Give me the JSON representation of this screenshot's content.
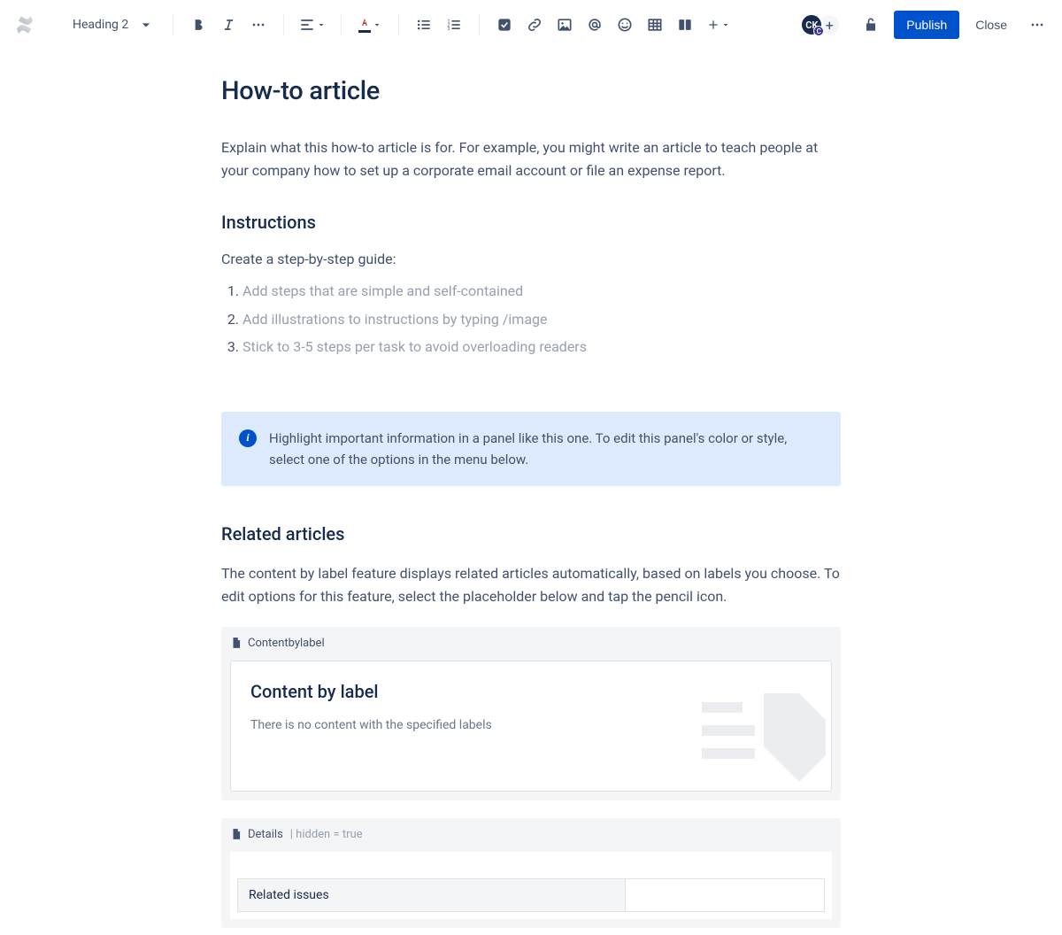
{
  "toolbar": {
    "style_label": "Heading 2",
    "publish": "Publish",
    "close": "Close"
  },
  "avatar": {
    "initials": "CK",
    "badge": "C"
  },
  "page": {
    "title": "How-to article",
    "intro": "Explain what this how-to article is for. For example, you might write an article to teach people at your company how to set up a corporate email account or file an expense report.",
    "instructions_heading": "Instructions",
    "instructions_sub": "Create a step-by-step guide:",
    "steps": [
      "Add steps that are simple and self-contained",
      "Add illustrations to instructions by typing /image",
      "Stick to 3-5 steps per task to avoid overloading readers"
    ],
    "panel_text": "Highlight important information in a panel like this one. To edit this panel's color or style, select one of the options in the menu below.",
    "related_heading": "Related articles",
    "related_intro": "The content by label feature displays related articles automatically, based on labels you choose. To edit options for this feature, select the placeholder below and tap the pencil icon."
  },
  "macro_cbl": {
    "header": "Contentbylabel",
    "title": "Content by label",
    "empty": "There is no content with the specified labels"
  },
  "macro_details": {
    "header": "Details",
    "hidden_meta": "| hidden = true",
    "row_label": "Related issues"
  }
}
